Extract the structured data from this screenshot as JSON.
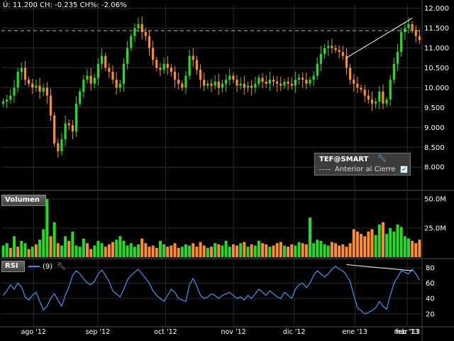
{
  "quote": {
    "text": "Ú: 11.200 CH: -0.235 CH%: -2.06%"
  },
  "price_panel": {
    "legend_symbol": "TEF@SMART",
    "legend_symbol_icon": "wrench-icon",
    "legend_prev_close": "Anterior al Cierre",
    "legend_checkbox_checked": true
  },
  "volume_panel": {
    "label": "Volumen"
  },
  "rsi_panel": {
    "label": "RSI",
    "period": "(9)",
    "icon": "wrench-icon"
  },
  "colors": {
    "background": "#000000",
    "up": "#22dd22",
    "down": "#ff8c2a",
    "rsi_line": "#3a8ee6",
    "trendline": "#ffffff",
    "grid": "#2a2a2a"
  },
  "chart_data": [
    {
      "type": "candlestick",
      "title": "TEF@SMART",
      "ylim": [
        7.7,
        12.1
      ],
      "yticks": [
        "12.000",
        "11.500",
        "11.000",
        "10.500",
        "10.000",
        "9.500",
        "9.000",
        "8.500",
        "8.000"
      ],
      "x_labels": [
        "ago '12",
        "sep '12",
        "oct '12",
        "nov '12",
        "dic '12",
        "ene '13",
        "feb '13",
        "mar '13"
      ],
      "previous_close": 11.435,
      "last": 11.2,
      "close_series": [
        9.65,
        9.7,
        9.8,
        10.0,
        10.4,
        10.5,
        10.2,
        10.1,
        10.0,
        10.05,
        9.9,
        10.0,
        9.8,
        9.3,
        8.6,
        8.4,
        8.7,
        9.1,
        9.05,
        8.9,
        9.6,
        9.9,
        10.2,
        10.3,
        10.1,
        10.25,
        10.6,
        10.8,
        10.5,
        10.4,
        10.2,
        10.0,
        10.1,
        10.6,
        11.0,
        11.3,
        11.5,
        11.6,
        11.4,
        11.3,
        11.0,
        10.7,
        10.5,
        10.45,
        10.6,
        10.5,
        10.4,
        10.2,
        10.1,
        10.0,
        10.3,
        10.8,
        10.7,
        10.45,
        10.2,
        10.05,
        10.1,
        10.05,
        10.15,
        10.0,
        10.1,
        10.2,
        10.3,
        10.2,
        10.05,
        10.1,
        10.0,
        10.05,
        10.0,
        10.1,
        10.25,
        10.15,
        10.1,
        10.2,
        10.15,
        10.1,
        10.05,
        10.15,
        10.1,
        10.05,
        10.2,
        10.25,
        10.2,
        10.1,
        10.2,
        10.3,
        10.6,
        10.85,
        11.0,
        11.05,
        11.0,
        10.95,
        10.9,
        10.8,
        10.5,
        10.2,
        10.1,
        10.0,
        9.95,
        9.8,
        9.7,
        9.6,
        9.65,
        9.9,
        9.6,
        9.7,
        10.2,
        10.6,
        10.9,
        11.4,
        11.5,
        11.6,
        11.45,
        11.3,
        11.2
      ],
      "trendline": {
        "from": 10.7,
        "to": 11.75
      }
    },
    {
      "type": "bar",
      "title": "Volumen",
      "ylim": [
        0,
        50000000
      ],
      "yticks": [
        "50.0M",
        "25.0M"
      ],
      "values": [
        10,
        12,
        8,
        18,
        9,
        14,
        12,
        7,
        9,
        11,
        15,
        24,
        50,
        18,
        30,
        12,
        10,
        18,
        14,
        22,
        10,
        9,
        16,
        12,
        7,
        10,
        14,
        12,
        9,
        11,
        13,
        15,
        18,
        14,
        10,
        12,
        9,
        11,
        16,
        12,
        9,
        10,
        8,
        14,
        11,
        9,
        10,
        12,
        8,
        9,
        11,
        10,
        12,
        9,
        13,
        10,
        8,
        9,
        12,
        11,
        10,
        14,
        9,
        11,
        10,
        12,
        13,
        9,
        11,
        10,
        14,
        12,
        11,
        9,
        10,
        12,
        13,
        10,
        9,
        11,
        10,
        13,
        12,
        11,
        34,
        12,
        15,
        14,
        11,
        10,
        13,
        12,
        10,
        11,
        9,
        12,
        24,
        22,
        20,
        18,
        22,
        24,
        19,
        28,
        30,
        20,
        25,
        22,
        28,
        26,
        18,
        16,
        14,
        12,
        15
      ],
      "up_flags": [
        1,
        1,
        0,
        1,
        0,
        1,
        1,
        0,
        1,
        0,
        1,
        1,
        1,
        0,
        1,
        0,
        1,
        1,
        0,
        1,
        1,
        1,
        1,
        0,
        0,
        1,
        1,
        1,
        0,
        0,
        0,
        1,
        1,
        1,
        1,
        1,
        1,
        1,
        0,
        0,
        0,
        0,
        0,
        1,
        1,
        0,
        0,
        0,
        0,
        1,
        1,
        1,
        0,
        0,
        0,
        0,
        1,
        0,
        1,
        0,
        1,
        1,
        1,
        0,
        0,
        1,
        0,
        1,
        0,
        1,
        1,
        0,
        0,
        1,
        0,
        0,
        0,
        1,
        0,
        0,
        1,
        1,
        0,
        0,
        1,
        1,
        1,
        1,
        1,
        1,
        0,
        0,
        0,
        0,
        0,
        0,
        0,
        0,
        0,
        0,
        0,
        0,
        1,
        1,
        0,
        1,
        1,
        1,
        1,
        1,
        1,
        1,
        0,
        0,
        0
      ]
    },
    {
      "type": "line",
      "title": "RSI",
      "series": [
        {
          "name": "RSI (9)"
        }
      ],
      "ylim": [
        5,
        90
      ],
      "yticks": [
        "80",
        "60",
        "40",
        "20"
      ],
      "values": [
        44,
        50,
        58,
        52,
        60,
        55,
        42,
        38,
        44,
        48,
        36,
        25,
        30,
        40,
        46,
        38,
        30,
        44,
        55,
        70,
        76,
        72,
        66,
        60,
        58,
        62,
        72,
        77,
        70,
        62,
        50,
        46,
        42,
        52,
        64,
        70,
        74,
        78,
        72,
        66,
        60,
        50,
        44,
        40,
        36,
        44,
        52,
        48,
        40,
        38,
        36,
        58,
        66,
        56,
        44,
        40,
        42,
        46,
        44,
        40,
        44,
        46,
        48,
        44,
        40,
        42,
        38,
        44,
        40,
        46,
        52,
        48,
        44,
        50,
        46,
        42,
        40,
        48,
        44,
        40,
        52,
        58,
        60,
        54,
        60,
        70,
        76,
        72,
        68,
        72,
        78,
        82,
        78,
        76,
        70,
        62,
        44,
        28,
        24,
        20,
        22,
        24,
        28,
        36,
        30,
        26,
        44,
        60,
        68,
        76,
        74,
        72,
        78,
        72,
        64
      ],
      "trendline": {
        "from": 84,
        "to": 76
      }
    }
  ]
}
